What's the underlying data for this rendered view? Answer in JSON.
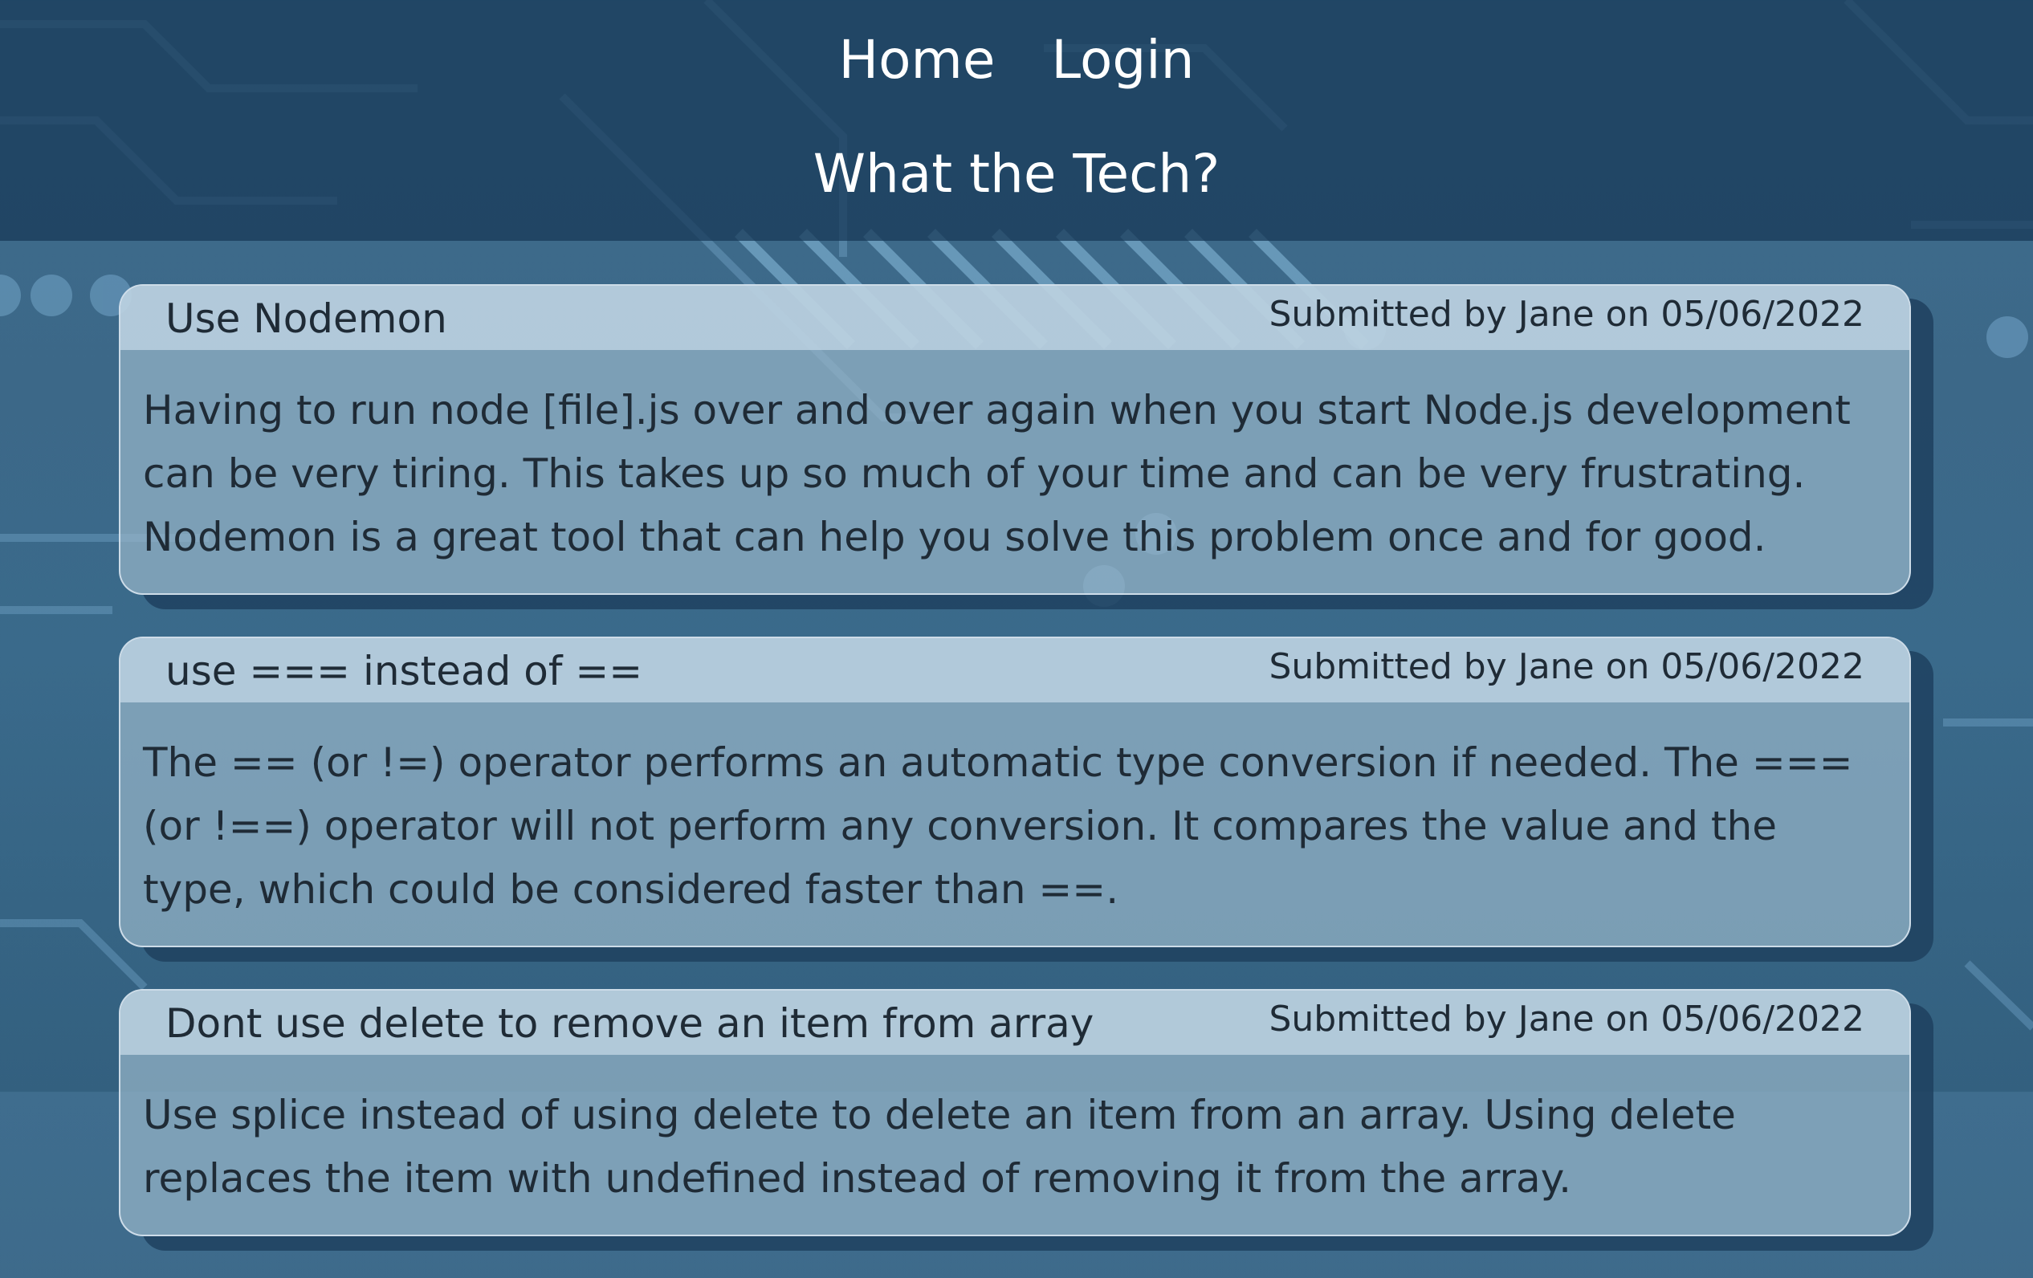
{
  "nav": {
    "home": "Home",
    "login": "Login"
  },
  "site": {
    "title": "What the Tech?"
  },
  "posts": [
    {
      "title": "Use Nodemon",
      "meta": "Submitted by Jane on 05/06/2022",
      "body": "Having to run node [file].js over and over again when you start Node.js development can be very tiring. This takes up so much of your time and can be very frustrating. Nodemon is a great tool that can help you solve this problem once and for good."
    },
    {
      "title": "use === instead of ==",
      "meta": "Submitted by Jane on 05/06/2022",
      "body": "The == (or !=) operator performs an automatic type conversion if needed. The === (or !==) operator will not perform any conversion. It compares the value and the type, which could be considered faster than ==."
    },
    {
      "title": "Dont use delete to remove an item from array",
      "meta": "Submitted by Jane on 05/06/2022",
      "body": "Use splice instead of using delete to delete an item from an array. Using delete replaces the item with undefined instead of removing it from the array."
    }
  ],
  "colors": {
    "header_bg": "#163756",
    "card_bg": "#96b4c8",
    "card_header_bg": "#c6d9e8",
    "text": "#1f2b36",
    "nav_text": "#ffffff"
  }
}
